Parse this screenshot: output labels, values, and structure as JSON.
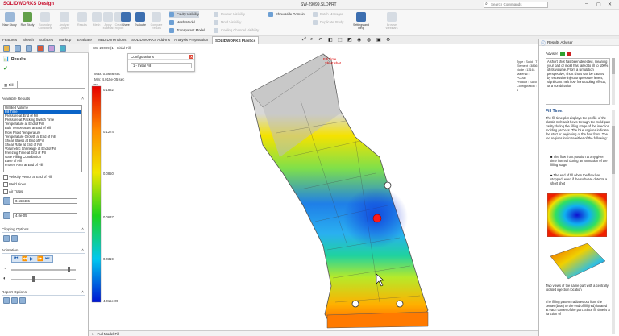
{
  "window": {
    "app_title": "SOLIDWORKS Design",
    "document": "SW-29099.SLDPRT",
    "search_placeholder": "Search Commands"
  },
  "ribbon": {
    "buttons": [
      {
        "label": "New Study",
        "enabled": true
      },
      {
        "label": "Run Study",
        "enabled": true
      },
      {
        "label": "Boundary Conditions",
        "enabled": false
      },
      {
        "label": "Analyze Options",
        "enabled": false
      },
      {
        "label": "Results",
        "enabled": false
      },
      {
        "label": "Mesh",
        "enabled": false
      },
      {
        "label": "Apply Material",
        "enabled": false
      },
      {
        "label": "Create Report",
        "enabled": false
      },
      {
        "label": "Share",
        "enabled": true
      },
      {
        "label": "Evaluate",
        "enabled": true
      },
      {
        "label": "Compare Results",
        "enabled": false
      },
      {
        "label": "Plot",
        "enabled": false
      }
    ],
    "view_group": [
      {
        "label": "Cavity Visibility",
        "enabled": true,
        "selected": true
      },
      {
        "label": "Mesh Model",
        "enabled": true,
        "selected": false
      },
      {
        "label": "Transparent Model",
        "enabled": true,
        "selected": false
      }
    ],
    "view_group2": [
      {
        "label": "Runner Visibility",
        "enabled": false
      },
      {
        "label": "Mold Visibility",
        "enabled": false
      },
      {
        "label": "Cooling Channel Visibility",
        "enabled": false
      }
    ],
    "show_hide_domain": "Show/Hide Domain",
    "batch_group": [
      {
        "label": "Batch Manager",
        "enabled": false
      },
      {
        "label": "Duplicate Study",
        "enabled": false
      }
    ],
    "settings_help": "Settings and Help",
    "browse_webinars": "Browse Webinars"
  },
  "tabs": [
    {
      "label": "Features",
      "active": false
    },
    {
      "label": "Sketch",
      "active": false
    },
    {
      "label": "Surfaces",
      "active": false
    },
    {
      "label": "Markup",
      "active": false
    },
    {
      "label": "Evaluate",
      "active": false
    },
    {
      "label": "MBD Dimensions",
      "active": false
    },
    {
      "label": "SOLIDWORKS Add-Ins",
      "active": false
    },
    {
      "label": "Analysis Preparation",
      "active": false
    },
    {
      "label": "SOLIDWORKS Plastics",
      "active": true
    }
  ],
  "left_panel": {
    "title": "Results",
    "fill_label": "Fill",
    "available_results_title": "Available Results",
    "results": [
      "Unfilled Volume",
      "Fill Time",
      "Pressure at End of Fill",
      "Pressure at Packing Switch Time",
      "Temperature at End of Fill",
      "Bulk Temperature at End of Fill",
      "Flow Front Temperature",
      "Temperature Growth at End of Fill",
      "Shear Stress at End of Fill",
      "Shear Rate at End of Fill",
      "Volumetric Shrinkage at End of Fill",
      "Freezing Time at End of Fill",
      "Gate Filling Contribution",
      "Ease of Fill",
      "Frozen Area at End of Fill"
    ],
    "selected_result": "Fill Time",
    "velocity_vector": "Velocity Vector at End of Fill",
    "weld_lines": "Weld Lines",
    "air_traps": "Air Traps",
    "max_value": "0.568486",
    "min_value": "4.0e-05",
    "clipping_title": "Clipping Options",
    "animation_title": "Animation",
    "report_title": "Report Options"
  },
  "viewport": {
    "tree_item": "SW-29099 (1 - Initial Fill)",
    "configurations_title": "Configurations",
    "configuration_value": "1 - Initial Fill",
    "max_label": "Max: 0.5686 sec",
    "min_label": "Min: 4.015e-05 sec",
    "unit": "sec",
    "legend_ticks": [
      "0.1882",
      "0.1274",
      "0.0850",
      "0.0637",
      "0.0319",
      "4.015e-05"
    ],
    "info_lines": [
      "Type : Solid - T",
      "Element : 3866",
      "Node : 13161",
      "Material : PC/AE",
      "Product : SABI",
      "Configuration : 1"
    ],
    "annot_top": "Fill Time",
    "annot_bottom": "Short shot",
    "status": "1 - Full Model Fill"
  },
  "right_panel": {
    "title": "Results Adviser",
    "adviser_label": "Adviser",
    "adviser_text": "A short shot has been detected, meaning your part or mold has failed to fill to 100% of its volume. From a simulation perspective, short shots can be caused by excessive injection pressure levels, significant melt flow front cooling effects, or a combination",
    "fill_time_heading": "Fill Time:",
    "fill_time_text": "The fill time plot displays the profile of the plastic melt as it flows through the mold part cavity during the filling stage of the injection molding process. The blue regions indicate the start or beginning of the flow front. The red regions indicate either of the following:",
    "bullet1": "The flow front position at any given time interval during an animation of the filling stage",
    "bullet2": "The end of fill when the flow has stopped, even if the software detects a short shot",
    "caption": "Two views of the same part with a centrally located injection location",
    "footer_text": "The filling pattern radiates out from the center (blue) to the end of fill (red) located at each corner of the part. Since fill time is a function of"
  },
  "colors": {
    "brand": "#c8102e",
    "selection": "#0a64c8",
    "panel_border": "#bbbbbb"
  }
}
